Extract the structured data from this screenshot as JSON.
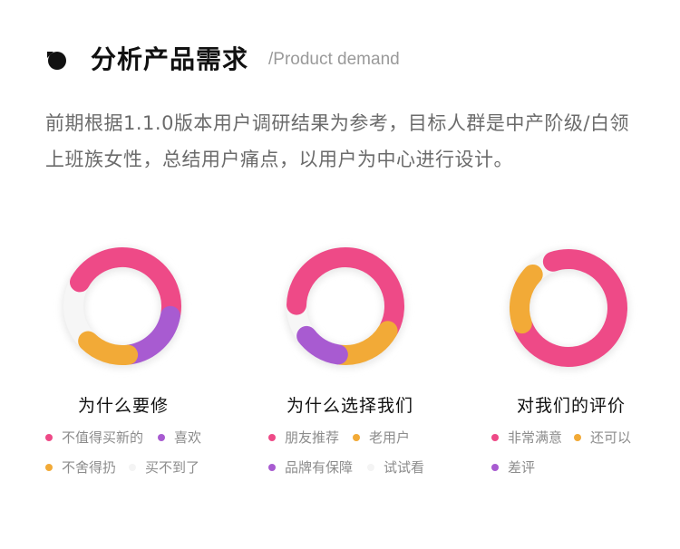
{
  "header": {
    "title": "分析产品需求",
    "subtitle": "/Product demand"
  },
  "description": "前期根据1.1.0版本用户调研结果为参考，目标人群是中产阶级/白领上班族女性，总结用户痛点，以用户为中心进行设计。",
  "colors": {
    "pink": "#ee4a87",
    "orange": "#f2aa37",
    "purple": "#a85bd1",
    "light": "#f0f0f0"
  },
  "chart_data": [
    {
      "type": "pie",
      "variant": "donut",
      "title": "为什么要修",
      "slices": [
        {
          "label": "不值得买新的",
          "value": 45,
          "color": "pink"
        },
        {
          "label": "喜欢",
          "value": 20,
          "color": "purple"
        },
        {
          "label": "不舍得扔",
          "value": 15,
          "color": "orange"
        },
        {
          "label": "买不到了",
          "value": 20,
          "color": "light"
        }
      ]
    },
    {
      "type": "pie",
      "variant": "donut",
      "title": "为什么选择我们",
      "slices": [
        {
          "label": "朋友推荐",
          "value": 58,
          "color": "pink"
        },
        {
          "label": "老用户",
          "value": 19,
          "color": "orange"
        },
        {
          "label": "品牌有保障",
          "value": 13,
          "color": "purple"
        },
        {
          "label": "试试看",
          "value": 10,
          "color": "light"
        }
      ]
    },
    {
      "type": "pie",
      "variant": "donut",
      "title": "对我们的评价",
      "slices": [
        {
          "label": "非常满意",
          "value": 75,
          "color": "pink"
        },
        {
          "label": "还可以",
          "value": 18,
          "color": "orange"
        },
        {
          "label": "差评",
          "value": 0,
          "color": "purple"
        },
        {
          "label": "",
          "value": 7,
          "color": "light"
        }
      ]
    }
  ]
}
